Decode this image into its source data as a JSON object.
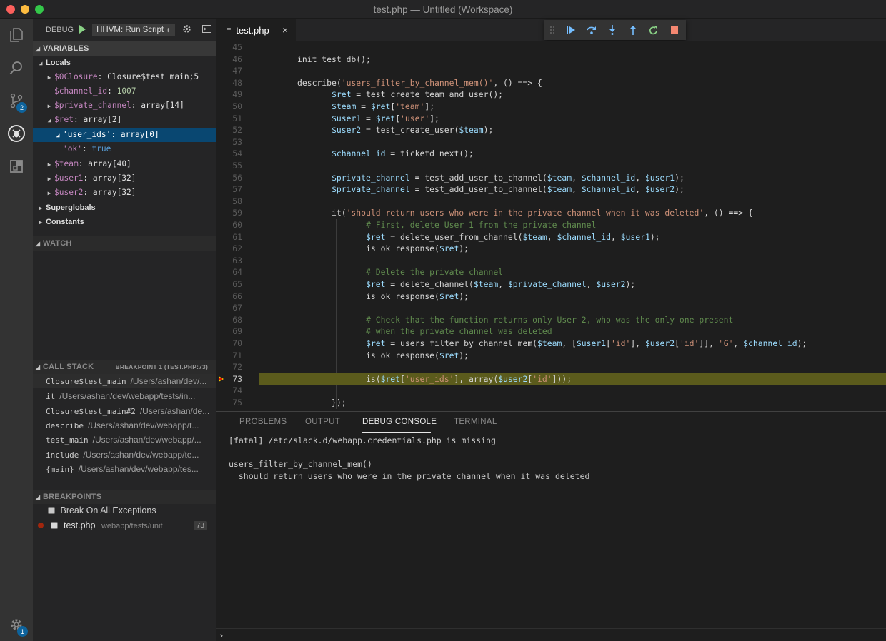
{
  "window": {
    "title": "test.php — Untitled (Workspace)"
  },
  "activity": {
    "scm_badge": "2",
    "settings_badge": "1"
  },
  "debug": {
    "label": "DEBUG",
    "config": "HHVM: Run Script"
  },
  "variables": {
    "header": "VARIABLES",
    "locals_label": "Locals",
    "rows": [
      {
        "name": "$0Closure",
        "value": "Closure$test_main;5"
      },
      {
        "name": "$channel_id",
        "value": "1007"
      },
      {
        "name": "$private_channel",
        "value": "array[14]"
      },
      {
        "name": "$ret",
        "value": "array[2]"
      },
      {
        "name": "'user_ids'",
        "value": "array[0]"
      },
      {
        "name": "'ok'",
        "value": "true"
      },
      {
        "name": "$team",
        "value": "array[40]"
      },
      {
        "name": "$user1",
        "value": "array[32]"
      },
      {
        "name": "$user2",
        "value": "array[32]"
      }
    ],
    "superglobals_label": "Superglobals",
    "constants_label": "Constants"
  },
  "watch": {
    "header": "WATCH"
  },
  "call_stack": {
    "header": "CALL STACK",
    "status": "BREAKPOINT 1 (TEST.PHP:73)",
    "frames": [
      {
        "fn": "Closure$test_main",
        "path": "/Users/ashan/dev/..."
      },
      {
        "fn": "it",
        "path": "/Users/ashan/dev/webapp/tests/in..."
      },
      {
        "fn": "Closure$test_main#2",
        "path": "/Users/ashan/de..."
      },
      {
        "fn": "describe",
        "path": "/Users/ashan/dev/webapp/t..."
      },
      {
        "fn": "test_main",
        "path": "/Users/ashan/dev/webapp/..."
      },
      {
        "fn": "include",
        "path": "/Users/ashan/dev/webapp/te..."
      },
      {
        "fn": "{main}",
        "path": "/Users/ashan/dev/webapp/tes..."
      }
    ]
  },
  "breakpoints": {
    "header": "BREAKPOINTS",
    "exceptions_label": "Break On All Exceptions",
    "file": "test.php",
    "file_path": "webapp/tests/unit",
    "line": "73"
  },
  "editor": {
    "tab_title": "test.php",
    "tab_close": "×",
    "current_line": "73",
    "lines": [
      {
        "n": "45",
        "t": ""
      },
      {
        "n": "46",
        "t": "init_test_db();"
      },
      {
        "n": "47",
        "t": ""
      },
      {
        "n": "48",
        "t": "describe('users_filter_by_channel_mem()', () ==> {"
      },
      {
        "n": "49",
        "t": "\t$ret = test_create_team_and_user();"
      },
      {
        "n": "50",
        "t": "\t$team = $ret['team'];"
      },
      {
        "n": "51",
        "t": "\t$user1 = $ret['user'];"
      },
      {
        "n": "52",
        "t": "\t$user2 = test_create_user($team);"
      },
      {
        "n": "53",
        "t": ""
      },
      {
        "n": "54",
        "t": "\t$channel_id = ticketd_next();"
      },
      {
        "n": "55",
        "t": ""
      },
      {
        "n": "56",
        "t": "\t$private_channel = test_add_user_to_channel($team, $channel_id, $user1);"
      },
      {
        "n": "57",
        "t": "\t$private_channel = test_add_user_to_channel($team, $channel_id, $user2);"
      },
      {
        "n": "58",
        "t": ""
      },
      {
        "n": "59",
        "t": "\tit('should return users who were in the private channel when it was deleted', () ==> {"
      },
      {
        "n": "60",
        "t": "\t\t# First, delete User 1 from the private channel"
      },
      {
        "n": "61",
        "t": "\t\t$ret = delete_user_from_channel($team, $channel_id, $user1);"
      },
      {
        "n": "62",
        "t": "\t\tis_ok_response($ret);"
      },
      {
        "n": "63",
        "t": ""
      },
      {
        "n": "64",
        "t": "\t\t# Delete the private channel"
      },
      {
        "n": "65",
        "t": "\t\t$ret = delete_channel($team, $private_channel, $user2);"
      },
      {
        "n": "66",
        "t": "\t\tis_ok_response($ret);"
      },
      {
        "n": "67",
        "t": ""
      },
      {
        "n": "68",
        "t": "\t\t# Check that the function returns only User 2, who was the only one present"
      },
      {
        "n": "69",
        "t": "\t\t# when the private channel was deleted"
      },
      {
        "n": "70",
        "t": "\t\t$ret = users_filter_by_channel_mem($team, [$user1['id'], $user2['id']], \"G\", $channel_id);"
      },
      {
        "n": "71",
        "t": "\t\tis_ok_response($ret);"
      },
      {
        "n": "72",
        "t": ""
      },
      {
        "n": "73",
        "t": "\t\tis($ret['user_ids'], array($user2['id']));"
      },
      {
        "n": "74",
        "t": ""
      },
      {
        "n": "75",
        "t": "\t});"
      }
    ]
  },
  "panel": {
    "tabs": [
      "PROBLEMS",
      "OUTPUT",
      "DEBUG CONSOLE",
      "TERMINAL"
    ],
    "active_tab": "DEBUG CONSOLE",
    "console_lines": [
      "[fatal] /etc/slack.d/webapp.credentials.php is missing",
      "",
      "users_filter_by_channel_mem()",
      "  should return users who were in the private channel when it was deleted"
    ],
    "prompt": "›"
  },
  "colors": {
    "accent": "#0e639c",
    "selection": "#094771",
    "current_line": "#4b4b18"
  }
}
